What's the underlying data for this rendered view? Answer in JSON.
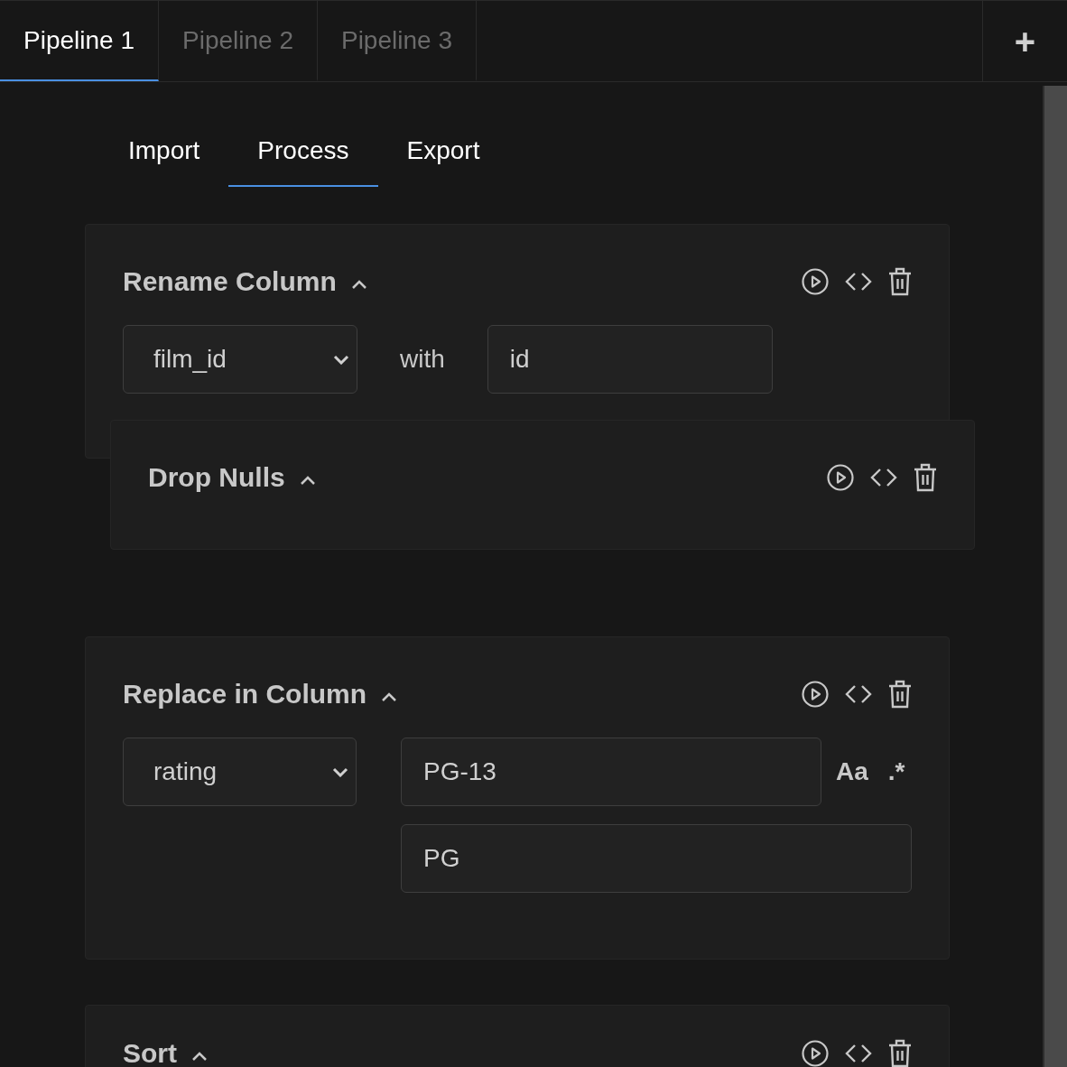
{
  "pipeline_tabs": [
    {
      "label": "Pipeline 1",
      "selected": true
    },
    {
      "label": "Pipeline 2",
      "selected": false
    },
    {
      "label": "Pipeline 3",
      "selected": false
    }
  ],
  "add_tab_label": "+",
  "stage_tabs": [
    {
      "label": "Import",
      "selected": false
    },
    {
      "label": "Process",
      "selected": true
    },
    {
      "label": "Export",
      "selected": false
    }
  ],
  "steps": [
    {
      "kind": "rename",
      "title": "Rename Column",
      "expanded": true,
      "dragging": false,
      "column": "film_id",
      "joiner": "with",
      "new_name": "id"
    },
    {
      "kind": "drop_nulls",
      "title": "Drop Nulls",
      "expanded": true,
      "dragging": true
    },
    {
      "kind": "replace",
      "title": "Replace in Column",
      "expanded": true,
      "dragging": false,
      "column": "rating",
      "find": "PG-13",
      "replace_with": "PG",
      "match_case_label": "Aa",
      "regex_label": ".*"
    },
    {
      "kind": "sort",
      "title": "Sort",
      "expanded": true,
      "dragging": false
    }
  ]
}
